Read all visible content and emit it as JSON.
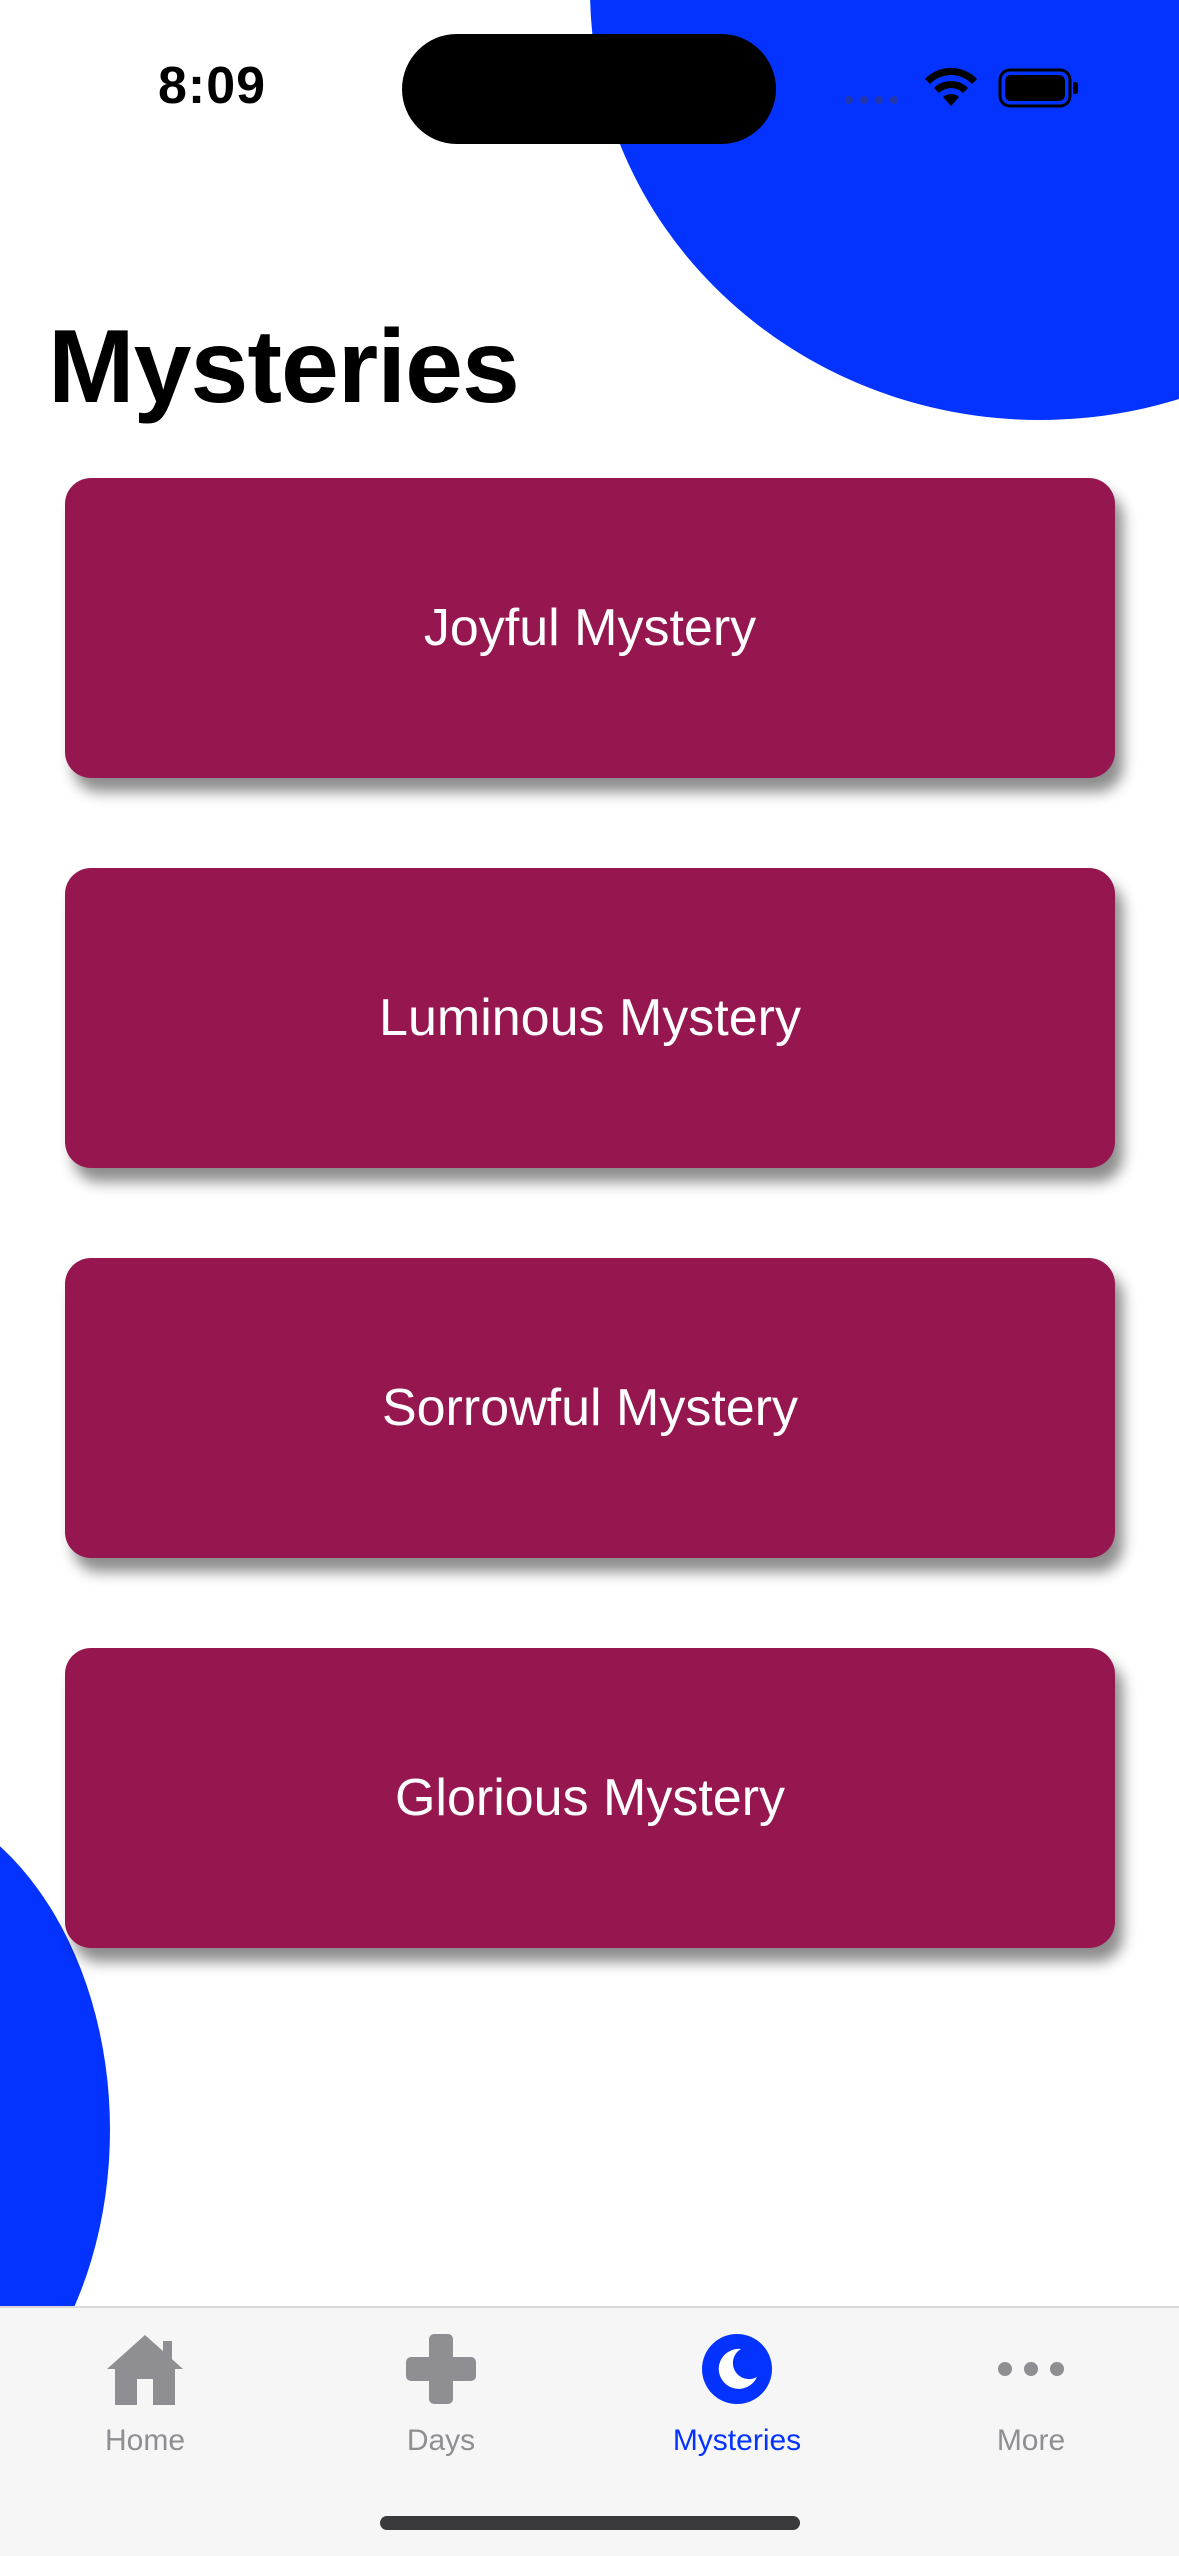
{
  "status_bar": {
    "time": "8:09"
  },
  "page_title": "Mysteries",
  "mysteries": [
    {
      "label": "Joyful Mystery"
    },
    {
      "label": "Luminous Mystery"
    },
    {
      "label": "Sorrowful Mystery"
    },
    {
      "label": "Glorious Mystery"
    }
  ],
  "tab_bar": {
    "tabs": [
      {
        "label": "Home",
        "icon": "house-icon",
        "active": false
      },
      {
        "label": "Days",
        "icon": "plus-cross-icon",
        "active": false
      },
      {
        "label": "Mysteries",
        "icon": "moon-icon",
        "active": true
      },
      {
        "label": "More",
        "icon": "ellipsis-icon",
        "active": false
      }
    ]
  },
  "colors": {
    "accent_blue": "#0433ff",
    "button_background": "#96174f",
    "button_text": "#ffffff",
    "inactive_tab": "#8e8e93"
  }
}
